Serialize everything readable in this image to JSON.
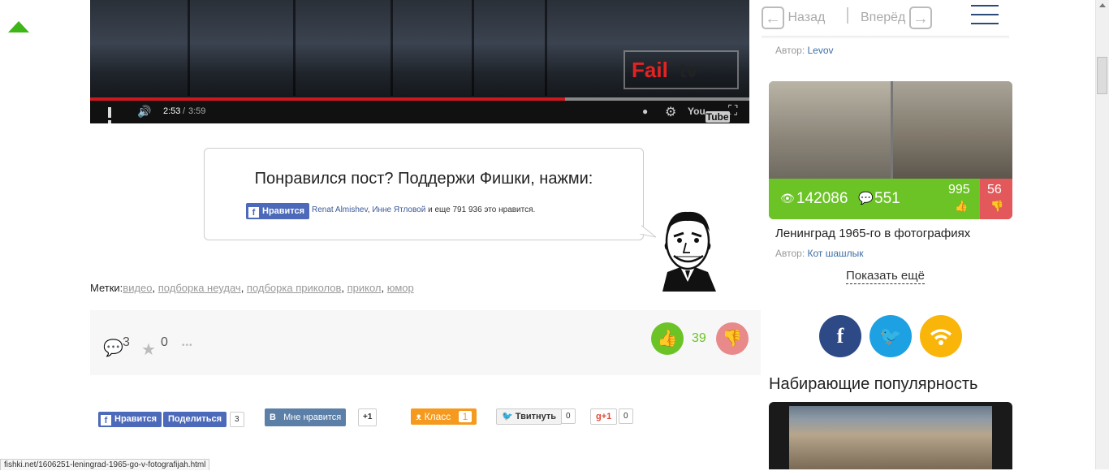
{
  "video": {
    "watermark": "Fail",
    "watermark_sub": "tv",
    "current_time": "2:53",
    "separator": " / ",
    "duration": "3:59",
    "progress_fraction": 0.72
  },
  "likebox": {
    "title": "Понравился пост? Поддержи Фишки, нажми:",
    "fb_button": "Нравится",
    "friend1": "Renat Almishev",
    "sep": ", ",
    "friend2": "Инне Ятловой",
    "tail_text": " и еще 791 936 это нравится."
  },
  "tags": {
    "label": "Метки:",
    "items": [
      "видео",
      "подборка неудач",
      "подборка приколов",
      "прикол",
      "юмор"
    ]
  },
  "stats": {
    "comments": "3",
    "favorites": "0",
    "more": "•••",
    "likes": "39"
  },
  "share": {
    "fb_like": "Нравится",
    "fb_share": "Поделиться",
    "fb_count": "3",
    "vk_label": "Мне нравится",
    "vk_count": "+1",
    "ok_label": "Класс",
    "ok_count": "1",
    "tw_label": "Твитнуть",
    "tw_count": "0",
    "gp_label": "+1",
    "gp_count": "0"
  },
  "nav": {
    "back": "Назад",
    "forward": "Вперёд"
  },
  "sidebar": {
    "author1_label": "Автор: ",
    "author1_name": "Levov",
    "post": {
      "views": "142086",
      "comments": "551",
      "likes": "995",
      "dislikes": "56",
      "title": "Ленинград 1965-го в фотографиях",
      "author_label": "Автор: ",
      "author_name": "Кот шашлык"
    },
    "show_more": "Показать ещё",
    "popular_title": "Набирающие популярность"
  },
  "status_url": "fishki.net/1606251-leningrad-1965-go-v-fotografijah.html",
  "colors": {
    "green": "#6cc326",
    "red": "#e3595b",
    "facebook": "#2d4a86",
    "twitter": "#1da1e2",
    "rss": "#f9b509"
  }
}
